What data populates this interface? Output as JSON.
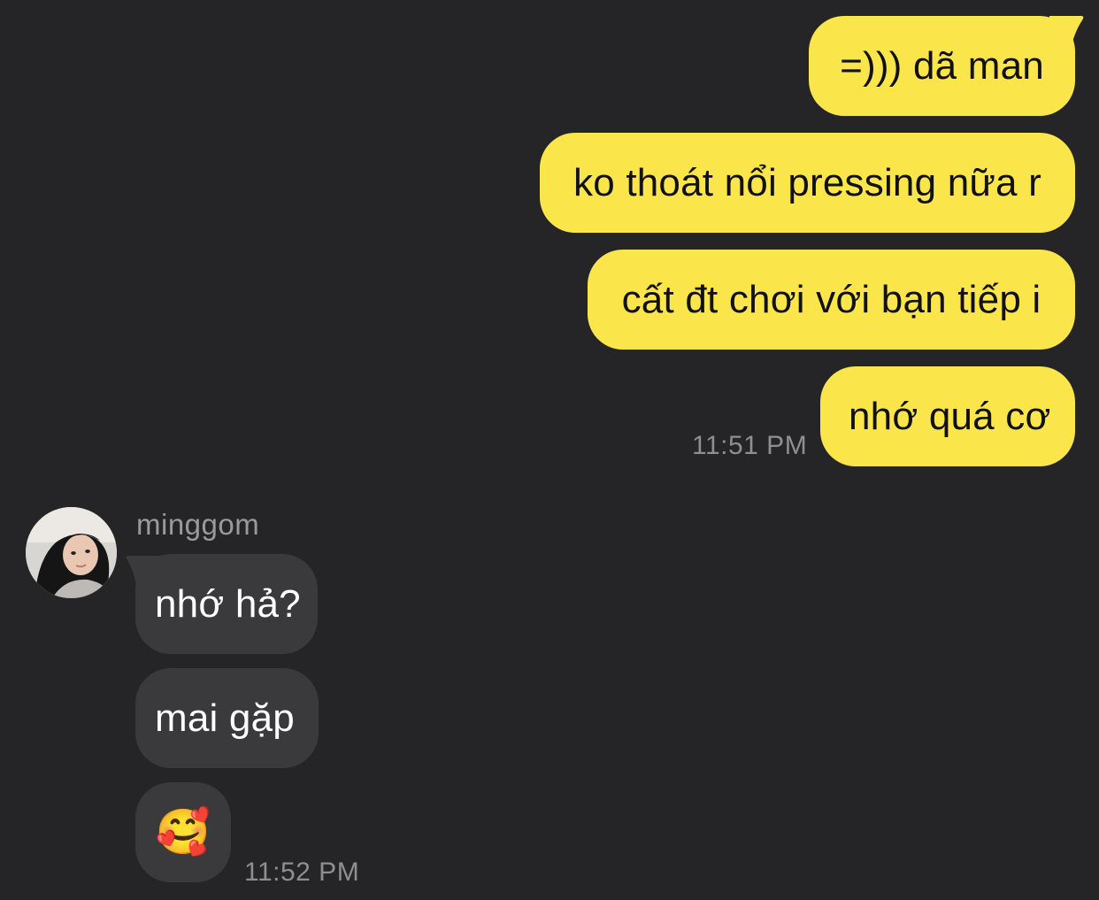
{
  "outgoing": [
    {
      "text": "=))) dã man"
    },
    {
      "text": "ko thoát nổi pressing nữa r"
    },
    {
      "text": "cất đt chơi với bạn tiếp i"
    },
    {
      "text": "nhớ quá cơ"
    }
  ],
  "outgoing_time": "11:51 PM",
  "sender": {
    "name": "minggom",
    "avatar": "avatar-photo"
  },
  "incoming": [
    {
      "text": "nhớ hả?"
    },
    {
      "text": "mai gặp"
    },
    {
      "text": "🥰"
    }
  ],
  "incoming_time": "11:52 PM",
  "colors": {
    "background": "#252527",
    "outgoing_bubble": "#FAE64B",
    "incoming_bubble": "#3A3A3C",
    "timestamp": "#8E8E93"
  }
}
